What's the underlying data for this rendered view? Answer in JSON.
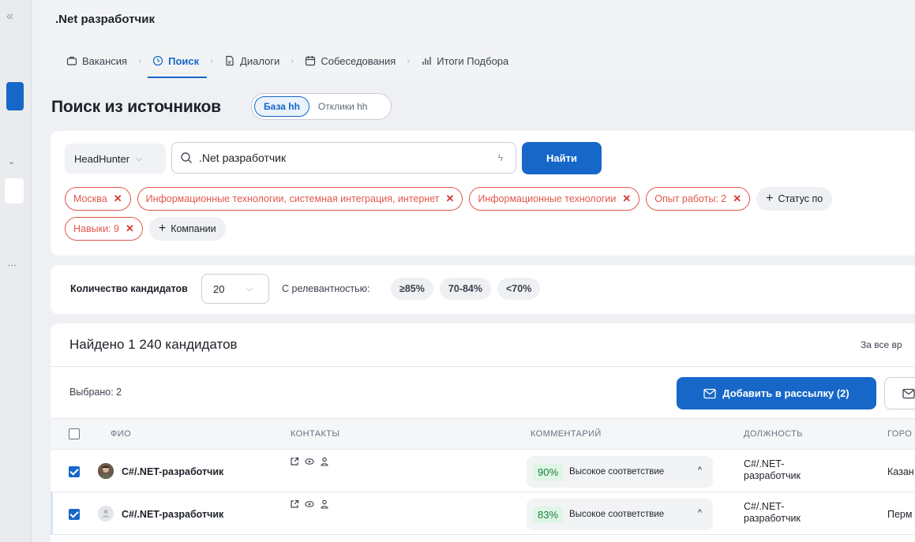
{
  "vacancy_title": ".Net разработчик",
  "tabs": [
    {
      "label": "Вакансия",
      "icon": "briefcase-icon"
    },
    {
      "label": "Поиск",
      "icon": "clock-icon"
    },
    {
      "label": "Диалоги",
      "icon": "document-icon"
    },
    {
      "label": "Собеседования",
      "icon": "calendar-icon"
    },
    {
      "label": "Итоги Подбора",
      "icon": "bar-chart-icon"
    }
  ],
  "heading": "Поиск из источников",
  "source_toggle": {
    "options": [
      "База hh",
      "Отклики hh"
    ],
    "selected": "База hh"
  },
  "search": {
    "source": "HeadHunter",
    "query": ".Net разработчик",
    "button": "Найти"
  },
  "filter_chips_row1": [
    "Москва",
    "Информационные технологии, системная интеграция, интернет",
    "Информационные технологии",
    "Опыт работы: 2"
  ],
  "add_status_label": "Статус по",
  "filter_chips_row2": [
    "Навыки: 9"
  ],
  "add_companies_label": "Компании",
  "count": {
    "label": "Количество кандидатов",
    "value": "20",
    "relevance_label": "С релевантностью:",
    "relevance_options": [
      "≥85%",
      "70-84%",
      "<70%"
    ]
  },
  "results": {
    "found": "Найдено 1 240 кандидатов",
    "period": "За все вр",
    "selected": "Выбрано: 2",
    "mail_button": "Добавить в рассылку (2)",
    "columns": [
      "ФИО",
      "КОНТАКТЫ",
      "КОММЕНТАРИЙ",
      "ДОЛЖНОСТЬ",
      "ГОРО"
    ],
    "rows": [
      {
        "name": "C#/.NET-разработчик",
        "pct": "90%",
        "comment": "Высокое соответствие",
        "position": "C#/.NET-разработчик",
        "city": "Казан",
        "checked": true,
        "photo": true
      },
      {
        "name": "C#/.NET-разработчик",
        "pct": "83%",
        "comment": "Высокое соответствие",
        "position": "C#/.NET-разработчик",
        "city": "Перм",
        "checked": true,
        "photo": false
      }
    ]
  },
  "colors": {
    "accent": "#1667c8",
    "chip_red": "#e2574c",
    "match_green": "#1a7f3c"
  }
}
